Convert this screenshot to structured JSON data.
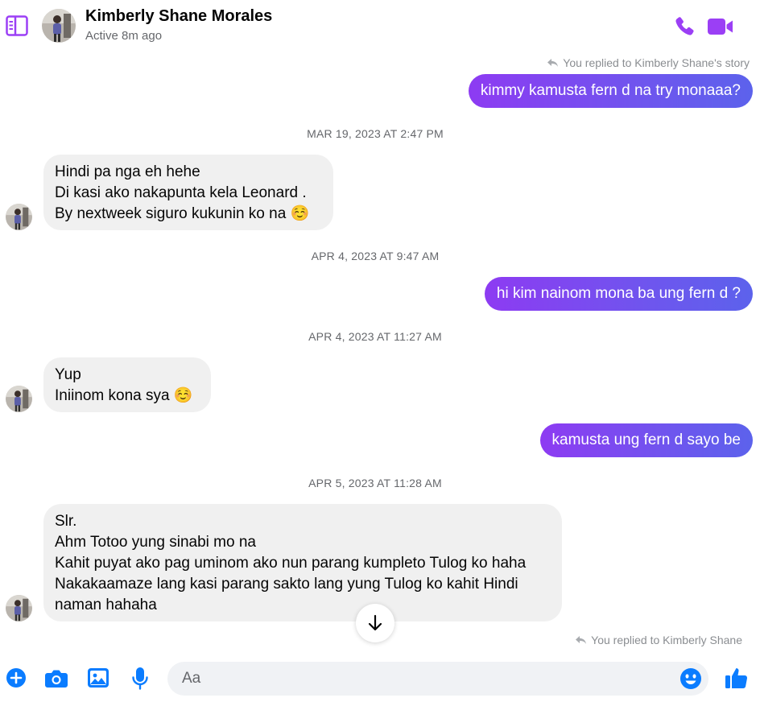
{
  "header": {
    "contact_name": "Kimberly Shane Morales",
    "status": "Active 8m ago",
    "accent_color": "#9b3ff5"
  },
  "messages": {
    "reply_note_1": "You replied to Kimberly Shane's story",
    "out_1": "kimmy kamusta fern d na try monaaa?",
    "ts_1": "MAR 19, 2023 AT 2:47 PM",
    "in_1": {
      "line1": "Hindi pa nga eh hehe",
      "line2": "Di kasi ako nakapunta kela Leonard .",
      "line3": "By nextweek siguro kukunin ko na ☺️"
    },
    "ts_2": "APR 4, 2023 AT 9:47 AM",
    "out_2": "hi kim nainom mona ba ung fern d ?",
    "ts_3": "APR 4, 2023 AT 11:27 AM",
    "in_2": {
      "line1": "Yup",
      "line2": "Iniinom kona sya ☺️"
    },
    "out_3": "kamusta ung fern d sayo be",
    "ts_4": "APR 5, 2023 AT 11:28 AM",
    "in_3": {
      "line1": "Slr.",
      "line2": "Ahm Totoo yung sinabi mo na",
      "line3": "Kahit puyat ako pag uminom ako nun parang kumpleto Tulog ko haha",
      "line4": "Nakakaamaze lang kasi parang sakto lang yung Tulog ko kahit Hindi",
      "line5": "naman hahaha"
    },
    "reply_note_2": "You replied to Kimberly Shane"
  },
  "composer": {
    "placeholder": "Aa",
    "icons": [
      "plus-icon",
      "camera-icon",
      "image-icon",
      "microphone-icon",
      "emoji-icon",
      "thumbs-up-icon"
    ]
  }
}
